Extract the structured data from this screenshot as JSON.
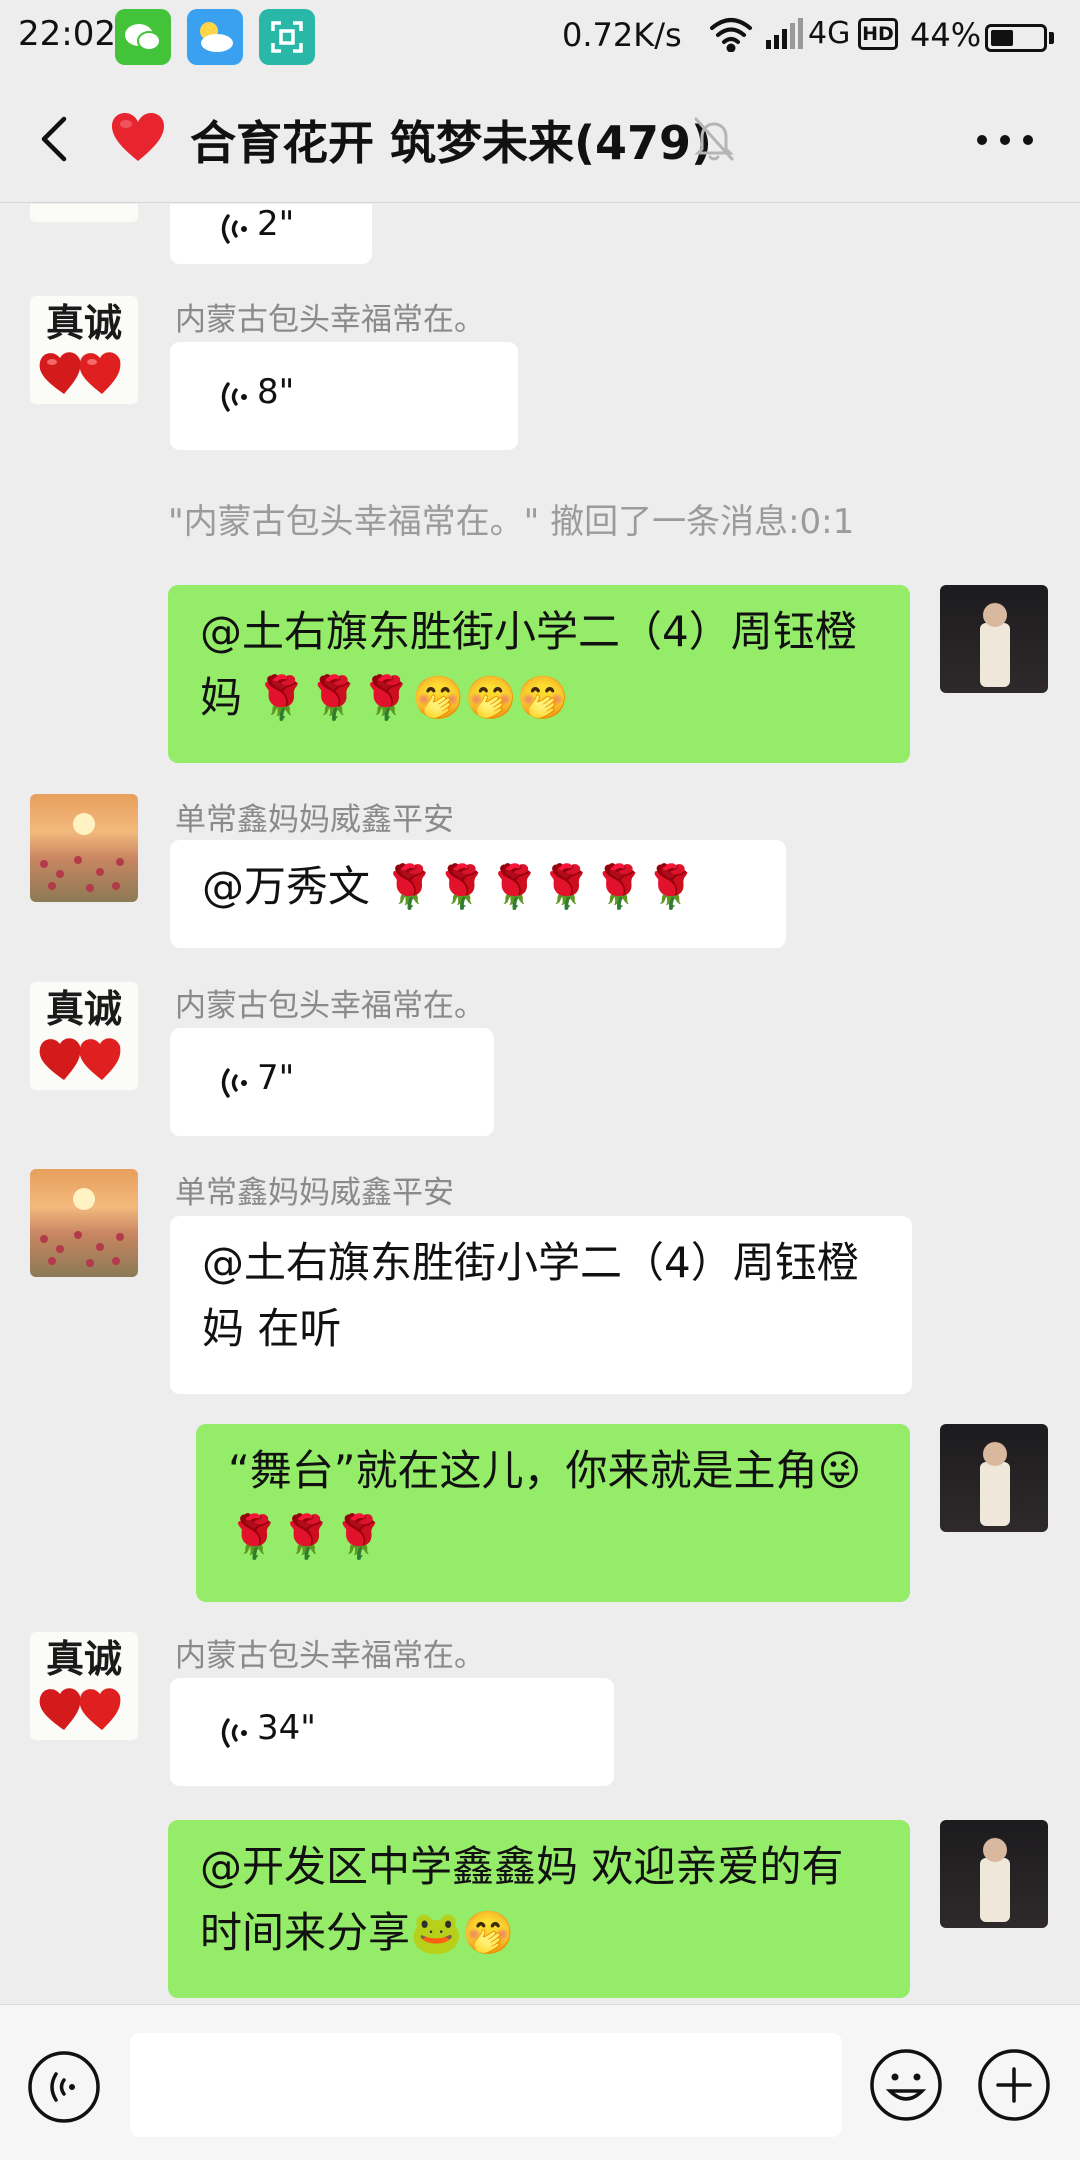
{
  "status_bar": {
    "time": "22:02",
    "speed": "0.72K/s",
    "network": "4G",
    "hd_badge": "HD",
    "battery": "44%",
    "battery_level": 0.44,
    "notification_icons": [
      "wechat-icon",
      "weather-icon",
      "scan-icon"
    ]
  },
  "header": {
    "title": "合育花开 筑梦未来(479)",
    "back_icon": "chevron-left-icon",
    "group_icon": "heart-icon",
    "mute_icon": "bell-muted-icon",
    "more_icon": "more-dots-icon"
  },
  "messages": [
    {
      "type": "voice",
      "side": "left",
      "duration": "2\"",
      "partial": true
    },
    {
      "type": "voice",
      "side": "left",
      "sender": "内蒙古包头幸福常在。",
      "duration": "8\"",
      "avatar_text": "真诚"
    },
    {
      "type": "system",
      "text": "\"内蒙古包头幸福常在。\" 撤回了一条消息:0:1"
    },
    {
      "type": "text",
      "side": "right",
      "text": "@土右旗东胜街小学二（4）周钰橙妈 🌹🌹🌹🤭🤭🤭"
    },
    {
      "type": "text",
      "side": "left",
      "sender": "单常鑫妈妈威鑫平安",
      "text": "@万秀文 🌹🌹🌹🌹🌹🌹"
    },
    {
      "type": "voice",
      "side": "left",
      "sender": "内蒙古包头幸福常在。",
      "duration": "7\"",
      "avatar_text": "真诚"
    },
    {
      "type": "text",
      "side": "left",
      "sender": "单常鑫妈妈威鑫平安",
      "text": "@土右旗东胜街小学二（4）周钰橙妈  在听"
    },
    {
      "type": "text",
      "side": "right",
      "text": "“舞台”就在这儿，你来就是主角😜🌹🌹🌹"
    },
    {
      "type": "voice",
      "side": "left",
      "sender": "内蒙古包头幸福常在。",
      "duration": "34\"",
      "avatar_text": "真诚"
    },
    {
      "type": "text",
      "side": "right",
      "text": "@开发区中学鑫鑫妈  欢迎亲爱的有时间来分享🐸🤭"
    }
  ],
  "input_bar": {
    "voice_icon": "voice-input-icon",
    "emoji_icon": "emoji-icon",
    "plus_icon": "plus-icon"
  },
  "colors": {
    "background": "#ededed",
    "bubble_self": "#95ec69",
    "bubble_other": "#ffffff",
    "sender_name": "#8a8a8a"
  }
}
